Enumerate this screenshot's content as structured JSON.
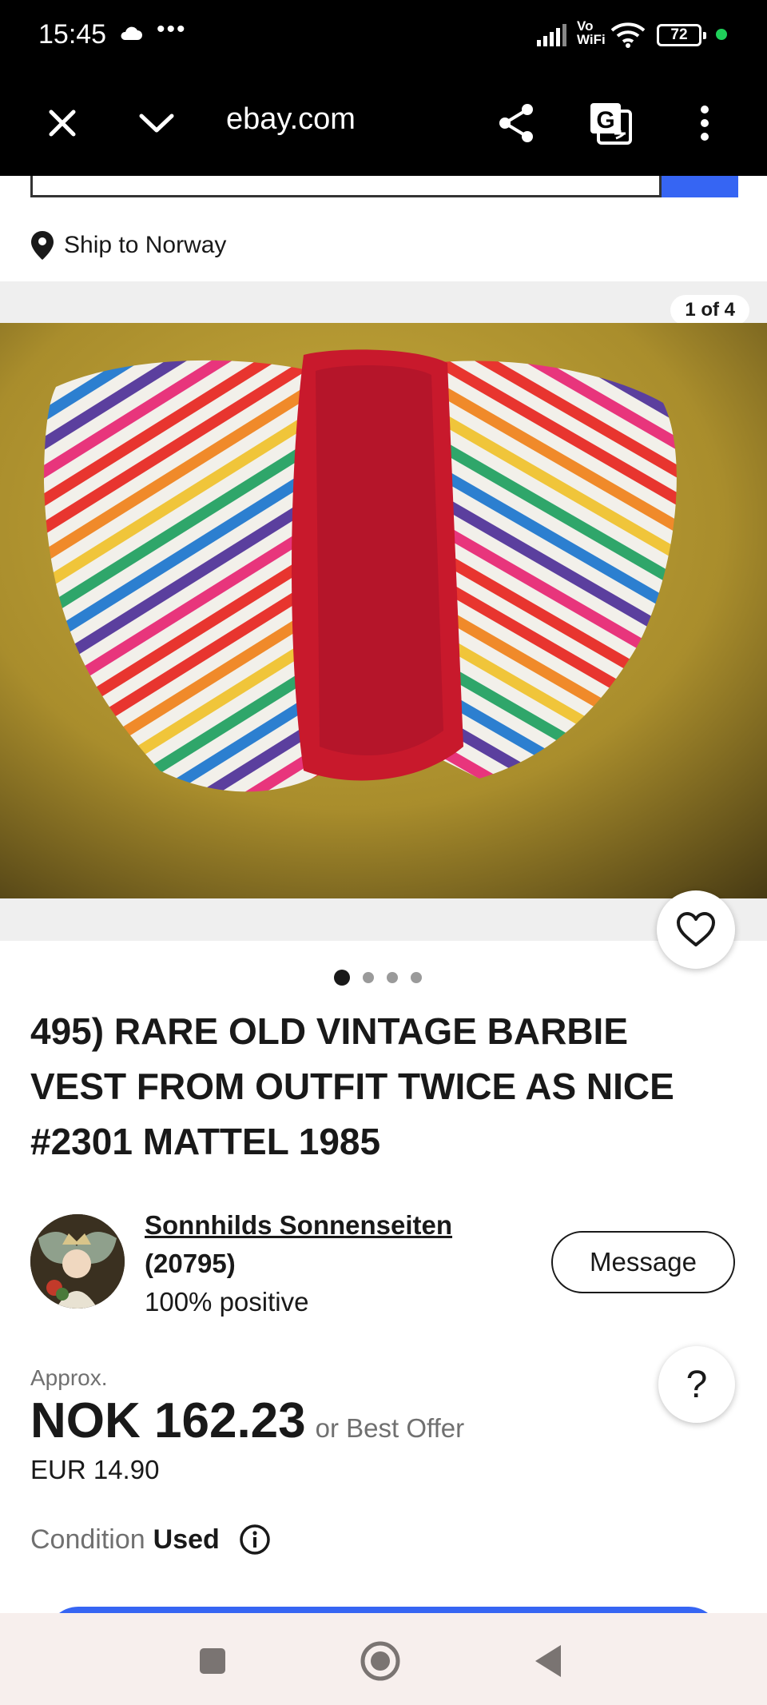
{
  "status_bar": {
    "time": "15:45",
    "more": "•••",
    "vowifi_top": "Vo",
    "vowifi_bottom": "WiFi",
    "battery": "72"
  },
  "browser": {
    "url": "ebay.com"
  },
  "shipping": {
    "label": "Ship to Norway"
  },
  "gallery": {
    "counter": "1 of 4",
    "dots": 4,
    "active_dot": 0
  },
  "listing": {
    "title": "495) RARE OLD VINTAGE BARBIE VEST FROM OUTFIT TWICE AS NICE #2301 MATTEL 1985"
  },
  "seller": {
    "name": "Sonnhilds Sonnenseiten",
    "feedback_count": "(20795)",
    "positive": "100% positive",
    "message_label": "Message"
  },
  "help": {
    "label": "?"
  },
  "price": {
    "approx_label": "Approx.",
    "amount": "NOK 162.23",
    "best_offer": "or Best Offer",
    "original": "EUR 14.90"
  },
  "condition": {
    "label": "Condition",
    "value": "Used"
  },
  "colors": {
    "brand_blue": "#3665f3",
    "text": "#191919",
    "muted": "#707070"
  }
}
